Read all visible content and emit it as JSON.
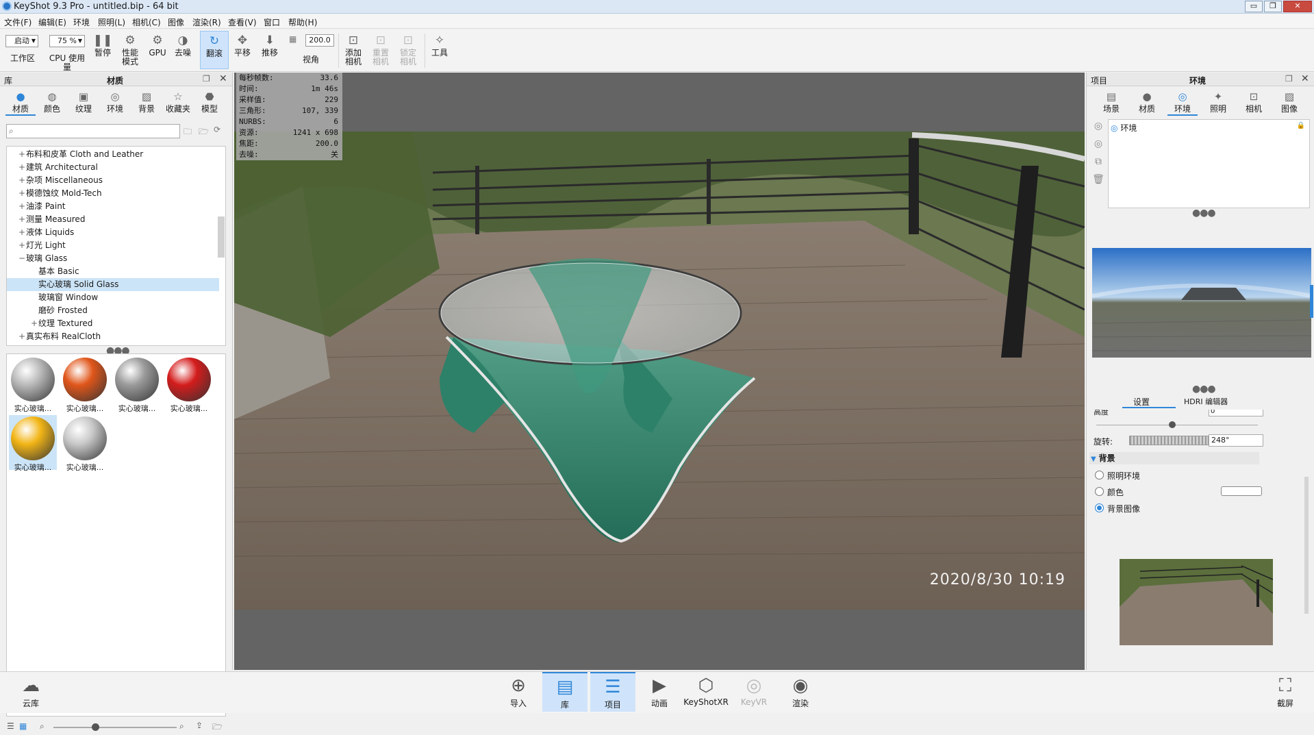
{
  "window": {
    "title": "KeyShot 9.3 Pro  - untitled.bip  - 64 bit",
    "controls": [
      "▭",
      "❐",
      "✕"
    ]
  },
  "menu": [
    "文件(F)",
    "编辑(E)",
    "环境",
    "照明(L)",
    "相机(C)",
    "图像",
    "渲染(R)",
    "查看(V)",
    "窗口",
    "帮助(H)"
  ],
  "ribbon": {
    "workspace_value": "启动",
    "workspace_label": "工作区",
    "cpu_value": "75 %",
    "cpu_label": "CPU 使用量",
    "pause": "暂停",
    "perf_mode": "性能\n模式",
    "gpu": "GPU",
    "denoise": "去噪",
    "tumble": "翻滚",
    "pan": "平移",
    "dolly": "推移",
    "fov_value": "200.0",
    "fov_label": "视角",
    "add_camera": "添加\n相机",
    "reset_camera": "重置\n相机",
    "lock_camera": "锁定\n相机",
    "tools": "工具"
  },
  "library": {
    "panel_label": "库",
    "title": "材质",
    "tabs": [
      "材质",
      "颜色",
      "纹理",
      "环境",
      "背景",
      "收藏夹",
      "模型"
    ],
    "search_placeholder": "",
    "tree": [
      {
        "label": "布料和皮革 Cloth and Leather",
        "expander": "+",
        "level": 0
      },
      {
        "label": "建筑 Architectural",
        "expander": "+",
        "level": 0
      },
      {
        "label": "杂项 Miscellaneous",
        "expander": "+",
        "level": 0
      },
      {
        "label": "模德蚀纹 Mold-Tech",
        "expander": "+",
        "level": 0
      },
      {
        "label": "油漆 Paint",
        "expander": "+",
        "level": 0
      },
      {
        "label": "测量 Measured",
        "expander": "+",
        "level": 0
      },
      {
        "label": "液体 Liquids",
        "expander": "+",
        "level": 0
      },
      {
        "label": "灯光 Light",
        "expander": "+",
        "level": 0
      },
      {
        "label": "玻璃 Glass",
        "expander": "−",
        "level": 0
      },
      {
        "label": "基本 Basic",
        "expander": "",
        "level": 1
      },
      {
        "label": "实心玻璃 Solid Glass",
        "expander": "",
        "level": 1,
        "selected": true
      },
      {
        "label": "玻璃窗 Window",
        "expander": "",
        "level": 1
      },
      {
        "label": "磨砂 Frosted",
        "expander": "",
        "level": 1
      },
      {
        "label": "纹理 Textured",
        "expander": "+",
        "level": 1
      },
      {
        "label": "真实布料 RealCloth",
        "expander": "+",
        "level": 0
      }
    ],
    "thumbnails": [
      {
        "label": "实心玻璃...",
        "color": "#b9b9b9"
      },
      {
        "label": "实心玻璃...",
        "color": "#e0561a"
      },
      {
        "label": "实心玻璃...",
        "color": "#9a9a9a"
      },
      {
        "label": "实心玻璃...",
        "color": "#d41c1c"
      },
      {
        "label": "实心玻璃...",
        "color": "#f2b516",
        "selected": true
      },
      {
        "label": "实心玻璃...",
        "color": "#c8c8c8"
      }
    ]
  },
  "stats": [
    {
      "k": "每秒帧数:",
      "v": "33.6"
    },
    {
      "k": "时间:",
      "v": "1m 46s"
    },
    {
      "k": "采样值:",
      "v": "229"
    },
    {
      "k": "三角形:",
      "v": "107, 339"
    },
    {
      "k": "NURBS:",
      "v": "6"
    },
    {
      "k": "资源:",
      "v": "1241 x 698"
    },
    {
      "k": "焦距:",
      "v": "200.0"
    },
    {
      "k": "去噪:",
      "v": "关"
    }
  ],
  "viewport": {
    "datestamp": "2020/8/30  10:19"
  },
  "project": {
    "panel_label": "项目",
    "title": "环境",
    "tabs": [
      "场景",
      "材质",
      "环境",
      "照明",
      "相机",
      "图像"
    ],
    "env_items": [
      {
        "label": "环境"
      }
    ],
    "subtabs": [
      "设置",
      "HDRI 编辑器"
    ],
    "height_label": "高度",
    "height_value": "0",
    "rotation_label": "旋转:",
    "rotation_value": "248°",
    "background_section": "背景",
    "bg_options": [
      {
        "label": "照明环境",
        "on": false
      },
      {
        "label": "颜色",
        "on": false
      },
      {
        "label": "背景图像",
        "on": true
      }
    ]
  },
  "bottom": {
    "cloud": "云库",
    "tools": [
      {
        "label": "导入",
        "icon": "⊕",
        "on": false
      },
      {
        "label": "库",
        "icon": "▤",
        "on": true
      },
      {
        "label": "项目",
        "icon": "☰",
        "on": true
      },
      {
        "label": "动画",
        "icon": "▶",
        "on": false
      },
      {
        "label": "KeyShotXR",
        "icon": "⬡",
        "on": false
      },
      {
        "label": "KeyVR",
        "icon": "◎",
        "on": false
      },
      {
        "label": "渲染",
        "icon": "◉",
        "on": false
      }
    ],
    "screenshot": "截屏"
  },
  "colors": {
    "accent": "#2f86d8",
    "selected_bg": "#cce4f7"
  }
}
